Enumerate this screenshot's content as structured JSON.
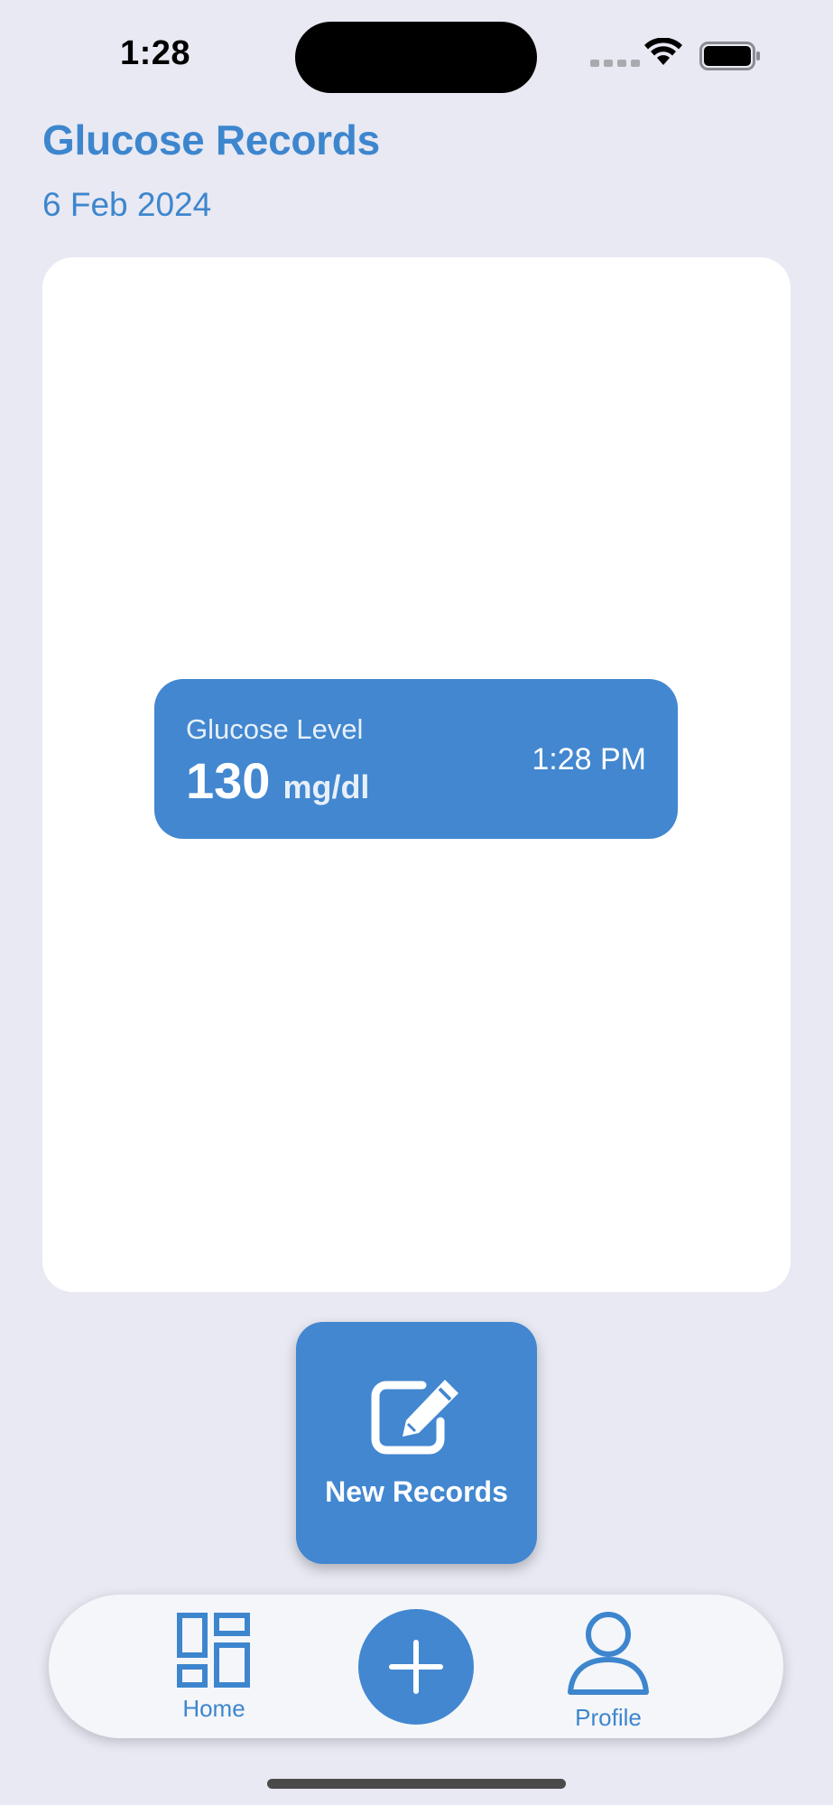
{
  "status_bar": {
    "time": "1:28"
  },
  "header": {
    "title": "Glucose Records",
    "date": "6 Feb 2024"
  },
  "record": {
    "label": "Glucose Level",
    "value": "130",
    "unit": "mg/dl",
    "time": "1:28 PM"
  },
  "new_records_button": {
    "label": "New Records",
    "icon": "edit-icon"
  },
  "tab_bar": {
    "home": {
      "label": "Home",
      "icon": "dashboard-icon"
    },
    "add": {
      "icon": "plus-icon"
    },
    "profile": {
      "label": "Profile",
      "icon": "person-icon"
    }
  },
  "colors": {
    "accent": "#4287D0",
    "title": "#3D86CE",
    "background": "#E8E9F3",
    "card": "#FFFFFF"
  }
}
